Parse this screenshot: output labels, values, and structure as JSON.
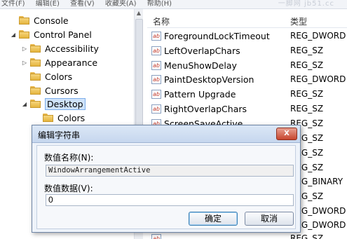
{
  "menubar": {
    "items": [
      "文件(F)",
      "编辑(E)",
      "查看(V)",
      "收藏夹(A)",
      "帮助(H)"
    ],
    "watermark": "一脚网 jb51.cc"
  },
  "tree": {
    "items": [
      {
        "label": "Console",
        "expander": ""
      },
      {
        "label": "Control Panel",
        "expander": "◢"
      },
      {
        "label": "Accessibility",
        "expander": "▷"
      },
      {
        "label": "Appearance",
        "expander": "▷"
      },
      {
        "label": "Colors",
        "expander": ""
      },
      {
        "label": "Cursors",
        "expander": ""
      },
      {
        "label": "Desktop",
        "expander": "◢"
      },
      {
        "label": "Colors",
        "expander": ""
      }
    ]
  },
  "list": {
    "header": {
      "name": "名称",
      "type": "类型"
    },
    "rows": [
      {
        "name": "ForegroundLockTimeout",
        "type": "REG_DWORD"
      },
      {
        "name": "LeftOverlapChars",
        "type": "REG_SZ"
      },
      {
        "name": "MenuShowDelay",
        "type": "REG_SZ"
      },
      {
        "name": "PaintDesktopVersion",
        "type": "REG_DWORD"
      },
      {
        "name": "Pattern Upgrade",
        "type": "REG_SZ"
      },
      {
        "name": "RightOverlapChars",
        "type": "REG_SZ"
      },
      {
        "name": "ScreenSaveActive",
        "type": "REG_SZ"
      },
      {
        "name": "",
        "type": "REG_SZ"
      },
      {
        "name": "",
        "type": "REG_SZ"
      },
      {
        "name": "",
        "type": "REG_SZ"
      },
      {
        "name": "",
        "type": "REG_BINARY"
      },
      {
        "name": "",
        "type": "REG_SZ"
      },
      {
        "name": "",
        "type": "REG_DWORD"
      },
      {
        "name": "",
        "type": "REG_DWORD"
      },
      {
        "name": "",
        "type": "REG_SZ"
      }
    ]
  },
  "dialog": {
    "title": "编辑字符串",
    "close_label": "X",
    "name_label": "数值名称(N):",
    "name_value": "WindowArrangementActive",
    "data_label": "数值数据(V):",
    "data_value": "0",
    "ok_label": "确定",
    "cancel_label": "取消"
  }
}
